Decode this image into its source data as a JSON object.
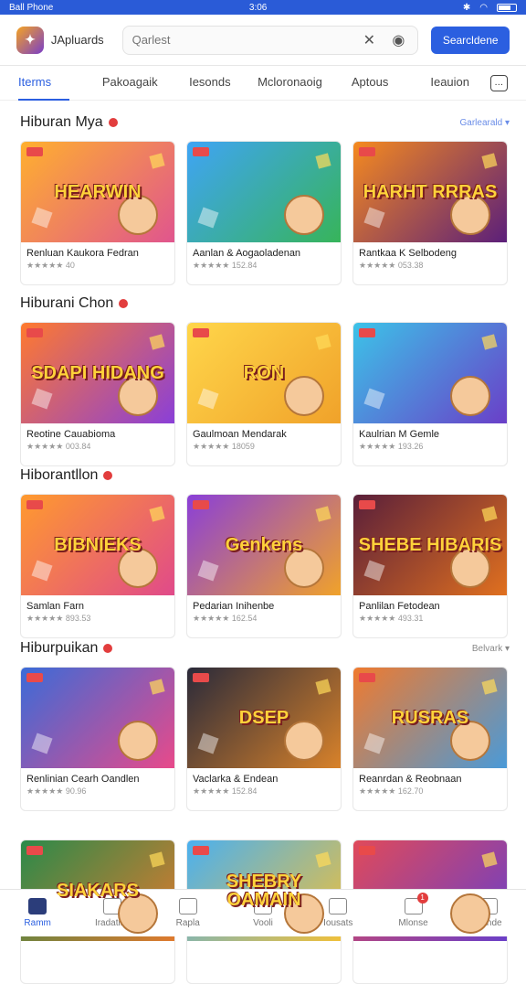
{
  "status": {
    "left": "Ball Phone",
    "time": "3:06"
  },
  "app": {
    "name": "JApluards",
    "search_placeholder": "Qarlest",
    "button": "Searcldene"
  },
  "tabs": [
    "Iterms",
    "Pakoagaik",
    "Iesonds",
    "Mcloronaoig",
    "Aptous",
    "Ieauion"
  ],
  "sections": [
    {
      "title": "Hiburan Mya",
      "see_all": "Garlearald ▾",
      "cards": [
        {
          "art": "HEARWIN",
          "title": "Renluan Kaukora Fedran",
          "meta": "★★★★★ 40",
          "colors": [
            "#ffb02e",
            "#e0558e"
          ]
        },
        {
          "art": "",
          "title": "Aanlan & Aogaoladenan",
          "meta": "★★★★★ 152.84",
          "colors": [
            "#3fa4f5",
            "#37b45a"
          ]
        },
        {
          "art": "HARHT RRRAS",
          "title": "Rantkaa K Selbodeng",
          "meta": "★★★★★ 053.38",
          "colors": [
            "#f58a1f",
            "#5b1f7a"
          ]
        }
      ]
    },
    {
      "title": "Hiburani Chon",
      "see_all": "",
      "cards": [
        {
          "art": "SDAPI HIDANG",
          "title": "Reotine Cauabioma",
          "meta": "★★★★★ 003.84",
          "colors": [
            "#ff7a2e",
            "#8a3fd8"
          ]
        },
        {
          "art": "RON",
          "title": "Gaulmoan Mendarak",
          "meta": "★★★★★ 18059",
          "colors": [
            "#ffd64a",
            "#f0a22a"
          ]
        },
        {
          "art": "",
          "title": "Kaulrian M Gemle",
          "meta": "★★★★★ 193.26",
          "colors": [
            "#3cc3e8",
            "#6a3fc8"
          ]
        }
      ]
    },
    {
      "title": "Hiborantllon",
      "see_all": "",
      "cards": [
        {
          "art": "BIBNIEKS",
          "title": "Samlan Farn",
          "meta": "★★★★★ 893.53",
          "colors": [
            "#ff9a2e",
            "#e04a8a"
          ]
        },
        {
          "art": "Genkens",
          "title": "Pedarian Inihenbe",
          "meta": "★★★★★ 162.54",
          "colors": [
            "#8a3fd8",
            "#f0a22a"
          ]
        },
        {
          "art": "SHEBE HIBARIS",
          "title": "Panlilan Fetodean",
          "meta": "★★★★★ 493.31",
          "colors": [
            "#5a1f3a",
            "#e0701f"
          ]
        }
      ]
    },
    {
      "title": "Hiburpuikan",
      "see_all": "Belvark ▾",
      "cards": [
        {
          "art": "",
          "title": "Renlinian Cearh Oandlen",
          "meta": "★★★★★ 90.96",
          "colors": [
            "#3a6bd8",
            "#e84a8a"
          ]
        },
        {
          "art": "DSEP",
          "title": "Vaclarka & Endean",
          "meta": "★★★★★ 152.84",
          "colors": [
            "#2a2a3a",
            "#d8822a"
          ]
        },
        {
          "art": "RUSRAS",
          "title": "Reanrdan & Reobnaan",
          "meta": "★★★★★ 162.70",
          "colors": [
            "#f07a2e",
            "#4a9ad8"
          ]
        }
      ]
    },
    {
      "title": "",
      "see_all": "",
      "cards": [
        {
          "art": "SIAKARS",
          "title": "",
          "meta": "",
          "colors": [
            "#2a8a4a",
            "#e07a2e"
          ]
        },
        {
          "art": "SHEBRY OAMAIN",
          "title": "",
          "meta": "",
          "colors": [
            "#4ab0f0",
            "#f0c03a"
          ]
        },
        {
          "art": "",
          "title": "",
          "meta": "",
          "colors": [
            "#e04a5a",
            "#6a3fc8"
          ]
        }
      ]
    }
  ],
  "nav": [
    {
      "label": "Ramm",
      "icon": "home-icon",
      "active": true
    },
    {
      "label": "Iradating",
      "icon": "image-icon"
    },
    {
      "label": "Rapla",
      "icon": "cube-icon"
    },
    {
      "label": "Vooli",
      "icon": "chart-icon"
    },
    {
      "label": "Iousats",
      "icon": "shield-icon"
    },
    {
      "label": "Mlonse",
      "icon": "chat-icon",
      "badge": "1"
    },
    {
      "label": "Dande",
      "icon": "search-icon"
    }
  ]
}
